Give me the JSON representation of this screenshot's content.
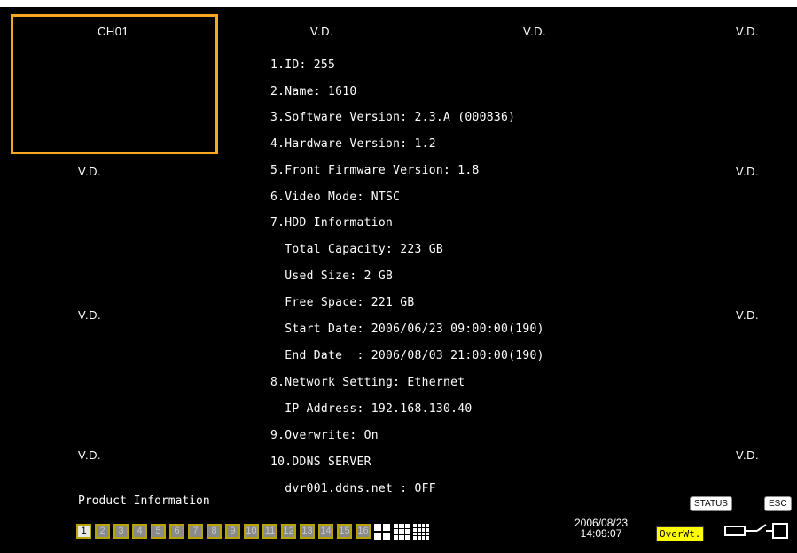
{
  "screen": {
    "channel_label": "CH01",
    "vd_label": "V.D."
  },
  "info": {
    "lines": [
      "1.ID: 255",
      "2.Name: 1610",
      "3.Software Version: 2.3.A (000836)",
      "4.Hardware Version: 1.2",
      "5.Front Firmware Version: 1.8",
      "6.Video Mode: NTSC",
      "7.HDD Information",
      "  Total Capacity: 223 GB",
      "  Used Size: 2 GB",
      "  Free Space: 221 GB",
      "  Start Date: 2006/06/23 09:00:00(190)",
      "  End Date  : 2006/08/03 21:00:00(190)",
      "8.Network Setting: Ethernet",
      "  IP Address: 192.168.130.40",
      "9.Overwrite: On",
      "10.DDNS SERVER",
      "  dvr001.ddns.net : OFF"
    ]
  },
  "footer": {
    "product_info": "Product Information",
    "status_button": "STATUS",
    "esc_button": "ESC",
    "date": "2006/08/23",
    "time": "14:09:07",
    "overwrite_badge": "OverWt.",
    "channels": [
      "1",
      "2",
      "3",
      "4",
      "5",
      "6",
      "7",
      "8",
      "9",
      "10",
      "11",
      "12",
      "13",
      "14",
      "15",
      "16"
    ],
    "active_channel": "1"
  },
  "colors": {
    "background": "#000000",
    "selection": "#f5a623",
    "text": "#ffffff",
    "overwrite_badge": "#ffff00"
  }
}
